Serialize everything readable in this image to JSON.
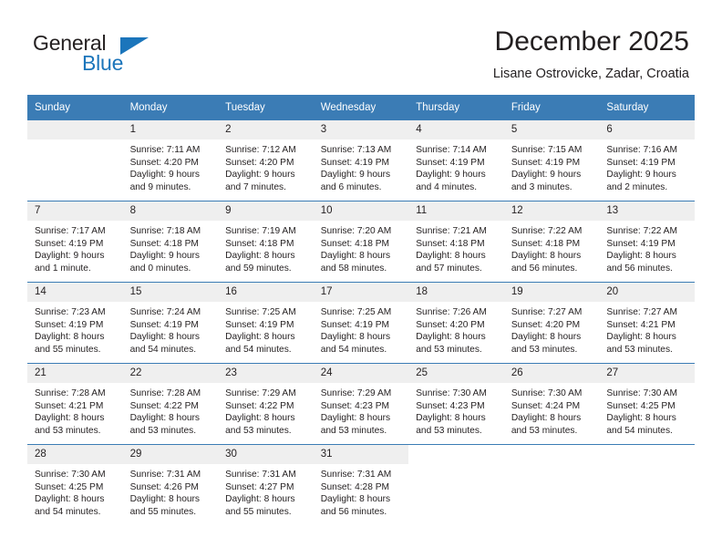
{
  "brand": {
    "name_part1": "General",
    "name_part2": "Blue",
    "triangle_icon": "blue-triangle-icon",
    "accent_color": "#1b75bb"
  },
  "header": {
    "title": "December 2025",
    "subtitle": "Lisane Ostrovicke, Zadar, Croatia"
  },
  "theme": {
    "header_blue": "#3b7cb5",
    "daynum_gray": "#efefef",
    "text": "#231f20"
  },
  "calendar": {
    "weekday_headers": [
      "Sunday",
      "Monday",
      "Tuesday",
      "Wednesday",
      "Thursday",
      "Friday",
      "Saturday"
    ],
    "weeks": [
      [
        {
          "day": "",
          "blank": true,
          "lines": []
        },
        {
          "day": "1",
          "lines": [
            "Sunrise: 7:11 AM",
            "Sunset: 4:20 PM",
            "Daylight: 9 hours",
            "and 9 minutes."
          ]
        },
        {
          "day": "2",
          "lines": [
            "Sunrise: 7:12 AM",
            "Sunset: 4:20 PM",
            "Daylight: 9 hours",
            "and 7 minutes."
          ]
        },
        {
          "day": "3",
          "lines": [
            "Sunrise: 7:13 AM",
            "Sunset: 4:19 PM",
            "Daylight: 9 hours",
            "and 6 minutes."
          ]
        },
        {
          "day": "4",
          "lines": [
            "Sunrise: 7:14 AM",
            "Sunset: 4:19 PM",
            "Daylight: 9 hours",
            "and 4 minutes."
          ]
        },
        {
          "day": "5",
          "lines": [
            "Sunrise: 7:15 AM",
            "Sunset: 4:19 PM",
            "Daylight: 9 hours",
            "and 3 minutes."
          ]
        },
        {
          "day": "6",
          "lines": [
            "Sunrise: 7:16 AM",
            "Sunset: 4:19 PM",
            "Daylight: 9 hours",
            "and 2 minutes."
          ]
        }
      ],
      [
        {
          "day": "7",
          "lines": [
            "Sunrise: 7:17 AM",
            "Sunset: 4:19 PM",
            "Daylight: 9 hours",
            "and 1 minute."
          ]
        },
        {
          "day": "8",
          "lines": [
            "Sunrise: 7:18 AM",
            "Sunset: 4:18 PM",
            "Daylight: 9 hours",
            "and 0 minutes."
          ]
        },
        {
          "day": "9",
          "lines": [
            "Sunrise: 7:19 AM",
            "Sunset: 4:18 PM",
            "Daylight: 8 hours",
            "and 59 minutes."
          ]
        },
        {
          "day": "10",
          "lines": [
            "Sunrise: 7:20 AM",
            "Sunset: 4:18 PM",
            "Daylight: 8 hours",
            "and 58 minutes."
          ]
        },
        {
          "day": "11",
          "lines": [
            "Sunrise: 7:21 AM",
            "Sunset: 4:18 PM",
            "Daylight: 8 hours",
            "and 57 minutes."
          ]
        },
        {
          "day": "12",
          "lines": [
            "Sunrise: 7:22 AM",
            "Sunset: 4:18 PM",
            "Daylight: 8 hours",
            "and 56 minutes."
          ]
        },
        {
          "day": "13",
          "lines": [
            "Sunrise: 7:22 AM",
            "Sunset: 4:19 PM",
            "Daylight: 8 hours",
            "and 56 minutes."
          ]
        }
      ],
      [
        {
          "day": "14",
          "lines": [
            "Sunrise: 7:23 AM",
            "Sunset: 4:19 PM",
            "Daylight: 8 hours",
            "and 55 minutes."
          ]
        },
        {
          "day": "15",
          "lines": [
            "Sunrise: 7:24 AM",
            "Sunset: 4:19 PM",
            "Daylight: 8 hours",
            "and 54 minutes."
          ]
        },
        {
          "day": "16",
          "lines": [
            "Sunrise: 7:25 AM",
            "Sunset: 4:19 PM",
            "Daylight: 8 hours",
            "and 54 minutes."
          ]
        },
        {
          "day": "17",
          "lines": [
            "Sunrise: 7:25 AM",
            "Sunset: 4:19 PM",
            "Daylight: 8 hours",
            "and 54 minutes."
          ]
        },
        {
          "day": "18",
          "lines": [
            "Sunrise: 7:26 AM",
            "Sunset: 4:20 PM",
            "Daylight: 8 hours",
            "and 53 minutes."
          ]
        },
        {
          "day": "19",
          "lines": [
            "Sunrise: 7:27 AM",
            "Sunset: 4:20 PM",
            "Daylight: 8 hours",
            "and 53 minutes."
          ]
        },
        {
          "day": "20",
          "lines": [
            "Sunrise: 7:27 AM",
            "Sunset: 4:21 PM",
            "Daylight: 8 hours",
            "and 53 minutes."
          ]
        }
      ],
      [
        {
          "day": "21",
          "lines": [
            "Sunrise: 7:28 AM",
            "Sunset: 4:21 PM",
            "Daylight: 8 hours",
            "and 53 minutes."
          ]
        },
        {
          "day": "22",
          "lines": [
            "Sunrise: 7:28 AM",
            "Sunset: 4:22 PM",
            "Daylight: 8 hours",
            "and 53 minutes."
          ]
        },
        {
          "day": "23",
          "lines": [
            "Sunrise: 7:29 AM",
            "Sunset: 4:22 PM",
            "Daylight: 8 hours",
            "and 53 minutes."
          ]
        },
        {
          "day": "24",
          "lines": [
            "Sunrise: 7:29 AM",
            "Sunset: 4:23 PM",
            "Daylight: 8 hours",
            "and 53 minutes."
          ]
        },
        {
          "day": "25",
          "lines": [
            "Sunrise: 7:30 AM",
            "Sunset: 4:23 PM",
            "Daylight: 8 hours",
            "and 53 minutes."
          ]
        },
        {
          "day": "26",
          "lines": [
            "Sunrise: 7:30 AM",
            "Sunset: 4:24 PM",
            "Daylight: 8 hours",
            "and 53 minutes."
          ]
        },
        {
          "day": "27",
          "lines": [
            "Sunrise: 7:30 AM",
            "Sunset: 4:25 PM",
            "Daylight: 8 hours",
            "and 54 minutes."
          ]
        }
      ],
      [
        {
          "day": "28",
          "lines": [
            "Sunrise: 7:30 AM",
            "Sunset: 4:25 PM",
            "Daylight: 8 hours",
            "and 54 minutes."
          ]
        },
        {
          "day": "29",
          "lines": [
            "Sunrise: 7:31 AM",
            "Sunset: 4:26 PM",
            "Daylight: 8 hours",
            "and 55 minutes."
          ]
        },
        {
          "day": "30",
          "lines": [
            "Sunrise: 7:31 AM",
            "Sunset: 4:27 PM",
            "Daylight: 8 hours",
            "and 55 minutes."
          ]
        },
        {
          "day": "31",
          "lines": [
            "Sunrise: 7:31 AM",
            "Sunset: 4:28 PM",
            "Daylight: 8 hours",
            "and 56 minutes."
          ]
        },
        {
          "day": "",
          "empty": true,
          "lines": []
        },
        {
          "day": "",
          "empty": true,
          "lines": []
        },
        {
          "day": "",
          "empty": true,
          "lines": []
        }
      ]
    ]
  }
}
